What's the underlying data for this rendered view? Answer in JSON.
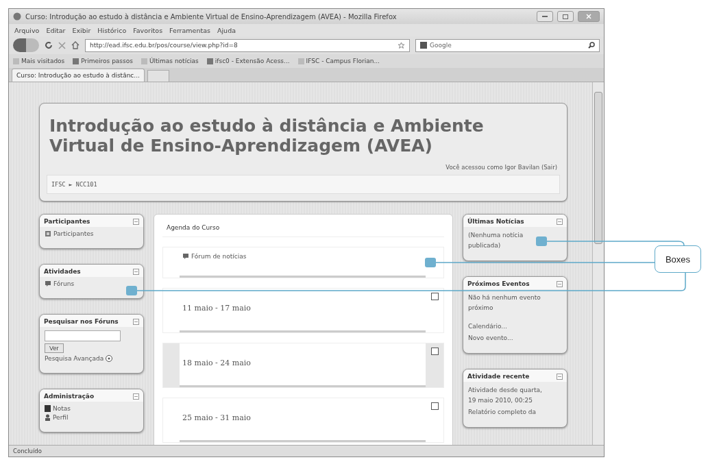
{
  "window": {
    "title": "Curso: Introdução ao estudo à distância e Ambiente Virtual de Ensino-Aprendizagem (AVEA) - Mozilla Firefox"
  },
  "menu_bar": [
    "Arquivo",
    "Editar",
    "Exibir",
    "Histórico",
    "Favoritos",
    "Ferramentas",
    "Ajuda"
  ],
  "toolbar": {
    "url": "http://ead.ifsc.edu.br/pos/course/view.php?id=8",
    "search_placeholder": "Google"
  },
  "bookmarks": [
    "Mais visitados",
    "Primeiros passos",
    "Últimas notícias",
    "ifsc0 - Extensão Acess...",
    "IFSC - Campus Florian..."
  ],
  "tabs": [
    {
      "label": "Curso: Introdução ao estudo à distânc...",
      "selected": true
    }
  ],
  "page": {
    "heading": "Introdução ao estudo à distância e Ambiente Virtual de Ensino-Aprendizagem (AVEA)",
    "login_info": "Você acessou como Igor Bavilan (Sair)",
    "breadcrumb": "IFSC ► NCC101",
    "left_blocks": [
      {
        "kind": "list",
        "title": "Participantes",
        "items": [
          "Participantes"
        ]
      },
      {
        "kind": "list",
        "title": "Atividades",
        "items": [
          "Fóruns"
        ]
      },
      {
        "kind": "search",
        "title": "Pesquisar nos Fóruns",
        "button": "Ver",
        "link": "Pesquisa Avançada"
      },
      {
        "kind": "list",
        "title": "Administração",
        "items": [
          "Notas",
          "Perfil"
        ]
      }
    ],
    "agenda": {
      "title": "Agenda do Curso",
      "sections": [
        {
          "kind": "forum",
          "label": "Fórum de notícias",
          "current": false
        },
        {
          "kind": "week",
          "label": "11 maio - 17 maio",
          "current": false
        },
        {
          "kind": "week",
          "label": "18 maio - 24 maio",
          "current": true
        },
        {
          "kind": "week",
          "label": "25 maio - 31 maio",
          "current": false
        }
      ]
    },
    "right_blocks": [
      {
        "title": "Últimas Notícias",
        "paragraphs": [
          [
            "(Nenhuma notícia publicada)"
          ]
        ]
      },
      {
        "title": "Próximos Eventos",
        "paragraphs": [
          [
            "Não há nenhum evento próximo"
          ],
          [
            "Calendário...",
            "Novo evento..."
          ]
        ]
      },
      {
        "title": "Atividade recente",
        "paragraphs": [
          [
            "Atividade desde quarta, 19 maio 2010, 00:25",
            "Relatório completo da"
          ]
        ]
      }
    ]
  },
  "status_bar": "Concluído",
  "callout": {
    "label": "Boxes"
  }
}
